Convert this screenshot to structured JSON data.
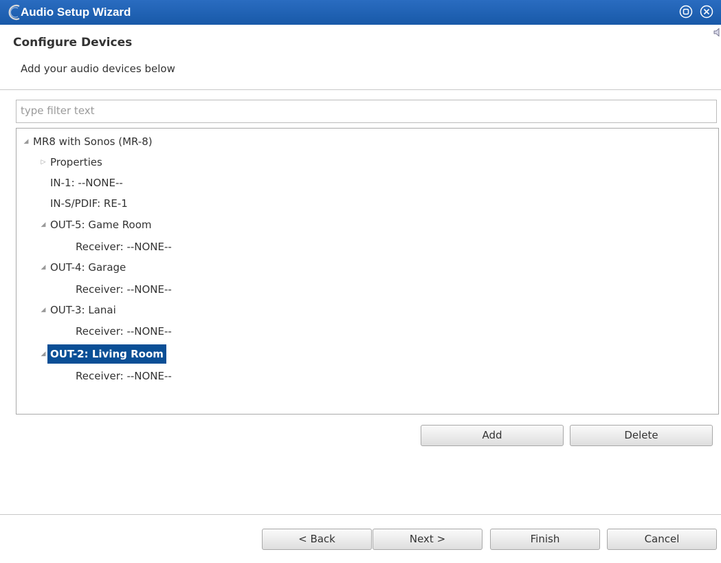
{
  "window": {
    "title": "Audio Setup Wizard",
    "accent_color": "#1e5faf",
    "controls": [
      "restore-icon",
      "close-icon"
    ]
  },
  "header": {
    "title": "Configure Devices",
    "description": "Add your audio devices below"
  },
  "filter": {
    "placeholder": "type filter text",
    "value": ""
  },
  "tree": {
    "selected_color": "#0a4f96",
    "nodes": [
      {
        "label": "MR8 with Sonos (MR-8)",
        "level": 0,
        "expander": "expanded"
      },
      {
        "label": "Properties",
        "level": 1,
        "expander": "collapsed"
      },
      {
        "label": "IN-1: --NONE--",
        "level": 1,
        "expander": "none"
      },
      {
        "label": "IN-S/PDIF: RE-1",
        "level": 1,
        "expander": "none"
      },
      {
        "label": "OUT-5: Game Room",
        "level": 1,
        "expander": "expanded"
      },
      {
        "label": "Receiver: --NONE--",
        "level": 2,
        "expander": "none"
      },
      {
        "label": "OUT-4: Garage",
        "level": 1,
        "expander": "expanded"
      },
      {
        "label": "Receiver: --NONE--",
        "level": 2,
        "expander": "none"
      },
      {
        "label": "OUT-3: Lanai",
        "level": 1,
        "expander": "expanded"
      },
      {
        "label": "Receiver: --NONE--",
        "level": 2,
        "expander": "none"
      },
      {
        "label": "OUT-2: Living Room",
        "level": 1,
        "expander": "expanded",
        "selected": true
      },
      {
        "label": "Receiver: --NONE--",
        "level": 2,
        "expander": "none"
      }
    ]
  },
  "actions": {
    "add_label": "Add",
    "delete_label": "Delete"
  },
  "footer": {
    "back_label": "< Back",
    "next_label": "Next >",
    "finish_label": "Finish",
    "cancel_label": "Cancel"
  }
}
